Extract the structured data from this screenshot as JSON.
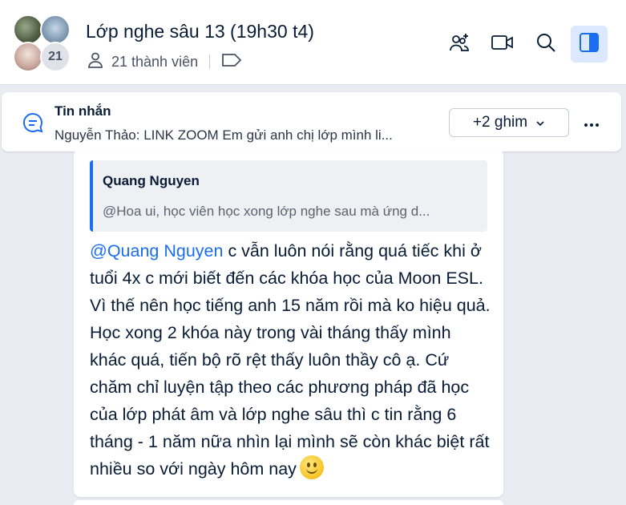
{
  "header": {
    "title": "Lớp nghe sâu 13 (19h30 t4)",
    "avatar_count": "21",
    "member_text": "21 thành viên"
  },
  "pinned": {
    "title": "Tin nhắn",
    "preview": "Nguyễn Thảo: LINK ZOOM Em gửi anh chị lớp mình li...",
    "pin_button": "+2 ghim"
  },
  "message": {
    "quote_author": "Quang Nguyen",
    "quote_text": "@Hoa ui, học viên học xong lớp nghe sau mà ứng d...",
    "mention": "@Quang Nguyen",
    "body": " c vẫn luôn nói rằng quá tiếc khi ở tuổi 4x c mới biết đến các khóa học của Moon ESL. Vì thế nên học tiếng anh 15 năm rồi mà ko hiệu quả. Học xong 2 khóa này trong vài tháng thấy mình khác quá, tiến bộ rõ rệt thấy luôn thầy cô ạ. Cứ chăm chỉ luyện tập theo các phương pháp đã học của lớp phát âm và lớp nghe sâu thì c tin rằng 6 tháng - 1 năm nữa nhìn lại mình sẽ còn khác biệt rất nhiều so với ngày hôm nay",
    "emoji": "smile-emoji"
  },
  "icons": [
    "add-member-icon",
    "video-call-icon",
    "search-icon",
    "sidebar-toggle-icon",
    "user-icon",
    "tag-icon",
    "chat-bubble-icon",
    "chevron-down-icon",
    "more-icon"
  ],
  "colors": {
    "accent": "#1a6eef",
    "background": "#e9edf3",
    "active_button": "#dbe8ff"
  }
}
